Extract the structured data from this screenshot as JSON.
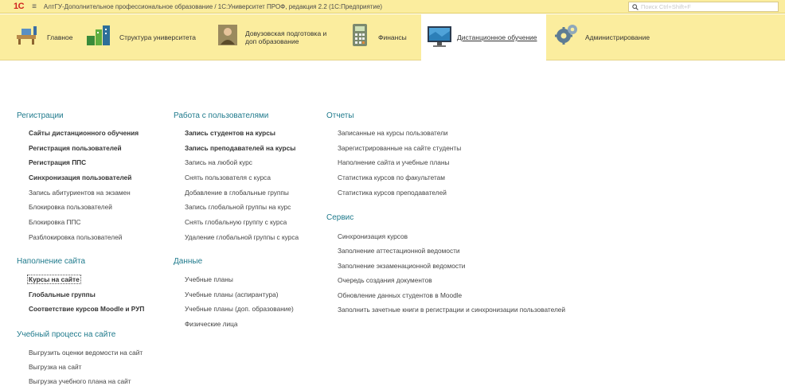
{
  "titlebar": {
    "logo": "1С",
    "menu_glyph": "≡",
    "title": "АлтГУ-Дополнительное профессиональное образование / 1С:Университет ПРОФ, редакция 2.2  (1С:Предприятие)",
    "search_placeholder": "Поиск Ctrl+Shift+F"
  },
  "sections": [
    {
      "label_lines": [
        "Главное"
      ],
      "icon": "desk-icon"
    },
    {
      "label_lines": [
        "Структура университета"
      ],
      "icon": "structure-icon"
    },
    {
      "label_lines": [
        "Довузовская подготовка и",
        "доп образование"
      ],
      "icon": "person-icon"
    },
    {
      "label_lines": [
        "Финансы"
      ],
      "icon": "calculator-icon"
    },
    {
      "label_lines": [
        "Дистанционное обучение"
      ],
      "icon": "monitor-icon",
      "active": true
    },
    {
      "label_lines": [
        "Администрирование"
      ],
      "icon": "gears-icon"
    }
  ],
  "col1": {
    "reg_title": "Регистрации",
    "reg_items": [
      "Сайты дистанционного обучения",
      "Регистрация пользователей",
      "Регистрация ППС",
      "Синхронизация пользователей",
      "Запись абитуриентов на экзамен",
      "Блокировка пользователей",
      "Блокировка ППС",
      "Разблокировка пользователей"
    ],
    "fill_title": "Наполнение сайта",
    "fill_items": [
      "Курсы на сайте",
      "Глобальные группы",
      "Соответствие курсов Moodle и РУП"
    ],
    "edu_title": "Учебный процесс на сайте",
    "edu_items": [
      "Выгрузить оценки ведомости на сайт",
      "Выгрузка на сайт",
      "Выгрузка учебного плана на сайт"
    ]
  },
  "col2": {
    "users_title": "Работа с пользователями",
    "users_items": [
      "Запись студентов на курсы",
      "Запись преподавателей на курсы",
      "Запись на любой курс",
      "Снять пользователя с курса",
      "Добавление в глобальные группы",
      "Запись глобальной группы на курс",
      "Снять глобальную группу с курса",
      "Удаление глобальной группы с курса"
    ],
    "data_title": "Данные",
    "data_items": [
      "Учебные планы",
      "Учебные планы (аспирантура)",
      "Учебные планы (доп. образование)",
      "Физические лица"
    ]
  },
  "col3": {
    "reports_title": "Отчеты",
    "reports_items": [
      "Записанные на курсы пользователи",
      "Зарегистрированные на сайте студенты",
      "Наполнение сайта и учебные планы",
      "Статистика курсов по факультетам",
      "Статистика курсов преподавателей"
    ],
    "service_title": "Сервис",
    "service_items": [
      "Синхронизация курсов",
      "Заполнение аттестационной ведомости",
      "Заполнение экзаменационной ведомости",
      "Очередь создания документов",
      "Обновление данных студентов в Moodle",
      "Заполнить зачетные книги в регистрации и синхронизации пользователей"
    ]
  },
  "colors": {
    "panel": "#fbed9e",
    "group_title": "#1f7a8c",
    "logo": "#d0231f"
  }
}
